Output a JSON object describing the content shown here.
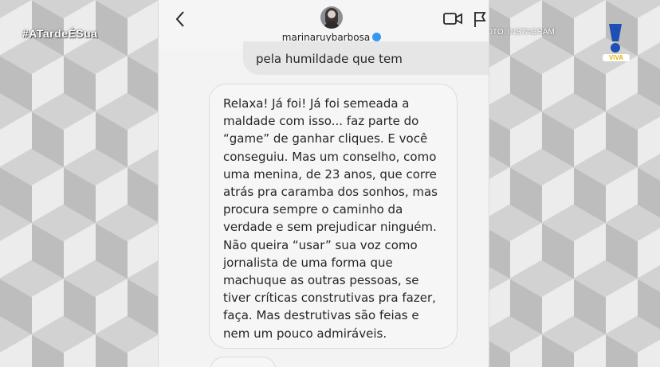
{
  "overlay": {
    "hashtag": "#ATardeÉSua",
    "photo_credit": "FOTO: INSTAGRAM",
    "logo_text": "ViVA"
  },
  "header": {
    "username": "marinaruybarbosa"
  },
  "messages": {
    "previous": "pela humildade que tem",
    "main": "Relaxa! Já foi! Já foi semeada a\nmaldade com isso... faz parte do\n“game” de ganhar cliques. E você\nconseguiu. Mas um conselho, como\numa menina, de 23 anos, que corre\natrás pra caramba dos sonhos, mas\nprocura sempre o caminho da\nverdade e sem prejudicar ninguém.\nNão queira “usar” sua voz como\njornalista de uma forma que\nmachuque as outras pessoas, se\ntiver críticas construtivas pra fazer,\nfaça. Mas destrutivas são feias e\nnem um pouco admiráveis."
  },
  "icons": {
    "back": "chevron-left-icon",
    "video": "video-camera-icon",
    "flag": "flag-icon",
    "verified": "verified-badge-icon"
  },
  "colors": {
    "verified": "#3897f0",
    "bubble_bg": "#f6f6f6",
    "bubble_border": "#dbdbdb",
    "logo_blue": "#1f4fb5",
    "logo_yellow": "#e8b300"
  }
}
